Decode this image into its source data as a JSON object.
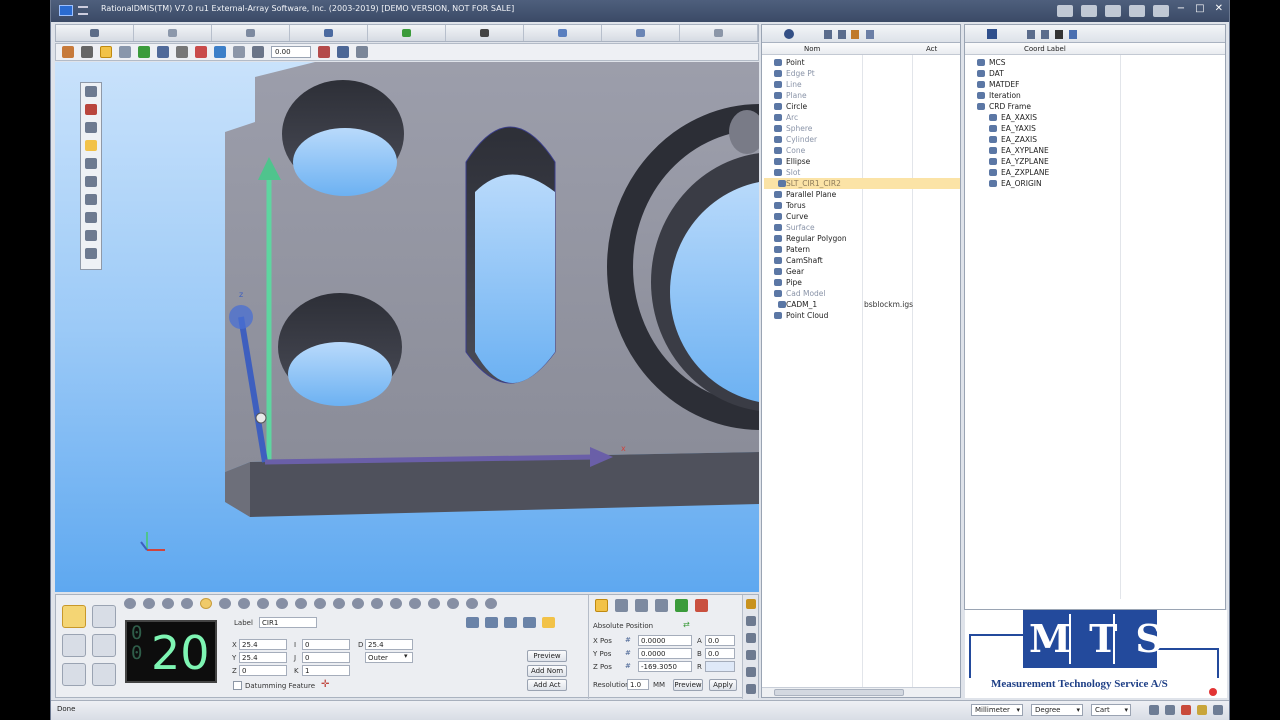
{
  "window": {
    "title": "RationalDMIS(TM) V7.0 ru1    External-Array Software, Inc. (2003-2019) [DEMO VERSION, NOT FOR SALE]",
    "controls": [
      "−",
      "□",
      "✕"
    ]
  },
  "toolbar": {
    "zoom_value": "0.00"
  },
  "viewport": {
    "axis_x": "x",
    "axis_z": "z"
  },
  "feature_panel": {
    "counter_small_top": "0",
    "counter_small_bottom": "0",
    "counter_big": "20",
    "label_caption": "Label",
    "label_value": "CIR1",
    "x_caption": "X",
    "x_value": "25.4",
    "y_caption": "Y",
    "y_value": "25.4",
    "z_caption": "Z",
    "z_value": "0",
    "i_caption": "I",
    "i_value": "0",
    "j_caption": "J",
    "j_value": "0",
    "k_caption": "K",
    "k_value": "1",
    "d_caption": "D",
    "d_value": "25.4",
    "mode_value": "Outer",
    "preview_button": "Preview",
    "add_nom_button": "Add Nom",
    "add_act_button": "Add Act",
    "datumming_label": "Datumming Feature"
  },
  "machine_panel": {
    "heading": "Absolute Position",
    "x_label": "X Pos",
    "x_value": "0.0000",
    "y_label": "Y Pos",
    "y_value": "0.0000",
    "z_label": "Z Pos",
    "z_value": "-169.3050",
    "a_label": "A",
    "a_value": "0.0",
    "b_label": "B",
    "b_value": "0.0",
    "r_label": "R",
    "r_value": "",
    "resolution_label": "Resolution",
    "resolution_value": "1.0",
    "resolution_unit": "MM",
    "preview_button": "Preview",
    "apply_button": "Apply"
  },
  "nominal_panel": {
    "col_nom": "Nom",
    "col_act": "Act",
    "items": [
      {
        "label": "Point",
        "dim": false,
        "child": false
      },
      {
        "label": "Edge Pt",
        "dim": true,
        "child": false
      },
      {
        "label": "Line",
        "dim": true,
        "child": false
      },
      {
        "label": "Plane",
        "dim": true,
        "child": false
      },
      {
        "label": "Circle",
        "dim": false,
        "child": false
      },
      {
        "label": "Arc",
        "dim": true,
        "child": false
      },
      {
        "label": "Sphere",
        "dim": true,
        "child": false
      },
      {
        "label": "Cylinder",
        "dim": true,
        "child": false
      },
      {
        "label": "Cone",
        "dim": true,
        "child": false
      },
      {
        "label": "Ellipse",
        "dim": false,
        "child": false
      },
      {
        "label": "Slot",
        "dim": true,
        "child": false
      },
      {
        "label": "SLT_CIR1_CIR2",
        "dim": false,
        "child": true,
        "highlight": true
      },
      {
        "label": "Parallel Plane",
        "dim": false,
        "child": false
      },
      {
        "label": "Torus",
        "dim": false,
        "child": false
      },
      {
        "label": "Curve",
        "dim": false,
        "child": false
      },
      {
        "label": "Surface",
        "dim": true,
        "child": false
      },
      {
        "label": "Regular Polygon",
        "dim": false,
        "child": false
      },
      {
        "label": "Patern",
        "dim": false,
        "child": false
      },
      {
        "label": "CamShaft",
        "dim": false,
        "child": false
      },
      {
        "label": "Gear",
        "dim": false,
        "child": false
      },
      {
        "label": "Pipe",
        "dim": false,
        "child": false
      },
      {
        "label": "Cad Model",
        "dim": true,
        "child": false
      },
      {
        "label": "CADM_1",
        "dim": false,
        "child": true,
        "act": "bsblockm.igs"
      },
      {
        "label": "Point Cloud",
        "dim": false,
        "child": false
      }
    ]
  },
  "coord_panel": {
    "col_label": "Coord Label",
    "items": [
      {
        "label": "MCS",
        "indent": 0
      },
      {
        "label": "DAT",
        "indent": 0
      },
      {
        "label": "MATDEF",
        "indent": 0
      },
      {
        "label": "Iteration",
        "indent": 0
      },
      {
        "label": "CRD Frame",
        "indent": 0
      },
      {
        "label": "EA_XAXIS",
        "indent": 1
      },
      {
        "label": "EA_YAXIS",
        "indent": 1
      },
      {
        "label": "EA_ZAXIS",
        "indent": 1
      },
      {
        "label": "EA_XYPLANE",
        "indent": 1
      },
      {
        "label": "EA_YZPLANE",
        "indent": 1
      },
      {
        "label": "EA_ZXPLANE",
        "indent": 1
      },
      {
        "label": "EA_ORIGIN",
        "indent": 1
      }
    ]
  },
  "logo": {
    "letters": "MTS",
    "caption": "Measurement Technology Service A/S"
  },
  "status_bar": {
    "text": "Done",
    "length_unit": "Millimeter",
    "angle_unit": "Degree",
    "coord_type": "Cart"
  },
  "colors": {
    "accent": "#f2c248",
    "part_gray": "#8d8f9a",
    "sky_top": "#c9e2fb",
    "sky_bottom": "#5ea8f0"
  }
}
